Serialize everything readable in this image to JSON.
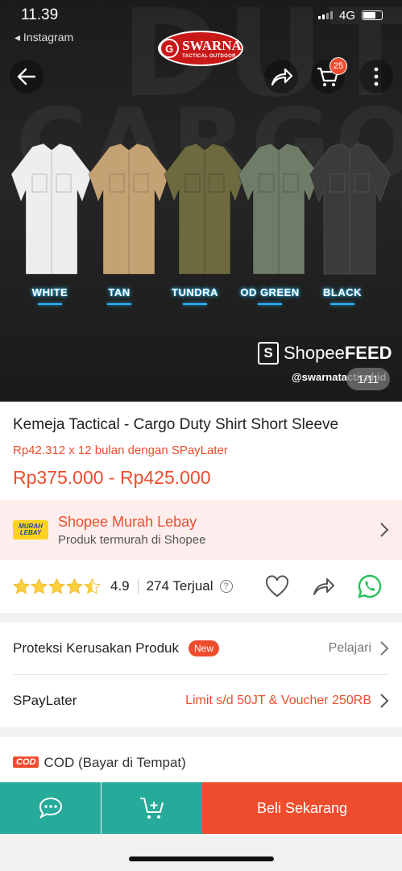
{
  "status_bar": {
    "time": "11.39",
    "network": "4G",
    "back_app": "◂ Instagram"
  },
  "header": {
    "back_icon": "arrow-left-icon",
    "share_icon": "share-icon",
    "cart_count": "25",
    "more_icon": "more-vertical-icon"
  },
  "logo": {
    "brand": "SWARNA",
    "tagline": "TACTICAL OUTDOOR"
  },
  "hero": {
    "colors": [
      "WHITE",
      "TAN",
      "TUNDRA",
      "OD GREEN",
      "BLACK"
    ],
    "feed_prefix": "Shopee",
    "feed_suffix": "FEED",
    "handle": "@swarnatactical.id",
    "image_counter": "1/11",
    "shirt_colors": [
      "#eceef0",
      "#c4a274",
      "#6e6a40",
      "#6f7c68",
      "#3b3b3b"
    ]
  },
  "product": {
    "title": "Kemeja Tactical - Cargo Duty Shirt Short Sleeve",
    "paylater": "Rp42.312 x 12 bulan dengan SPayLater",
    "price": "Rp375.000 - Rp425.000"
  },
  "murah": {
    "badge_line1": "MURAH",
    "badge_line2": "LEBAY",
    "title": "Shopee Murah Lebay",
    "subtitle": "Produk termurah di Shopee"
  },
  "rating": {
    "stars": 4.5,
    "score": "4.9",
    "sold": "274 Terjual"
  },
  "protection": {
    "label": "Proteksi Kerusakan Produk",
    "badge": "New",
    "action": "Pelajari"
  },
  "spaylater": {
    "label": "SPayLater",
    "value": "Limit s/d 50JT & Voucher 250RB"
  },
  "cod": {
    "badge": "COD",
    "label": "COD (Bayar di Tempat)"
  },
  "bottom_bar": {
    "buy_label": "Beli Sekarang"
  },
  "colors": {
    "accent": "#ee4d2d",
    "teal": "#26aa99",
    "star": "#ffce3d"
  }
}
